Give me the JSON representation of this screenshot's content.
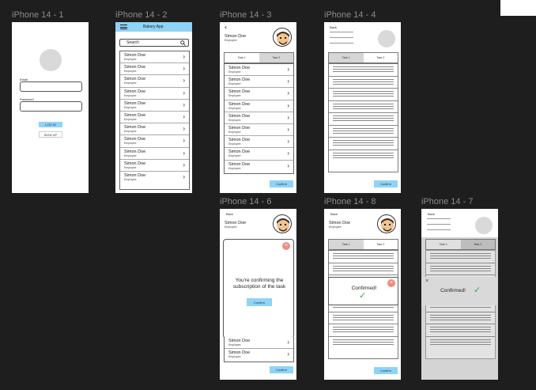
{
  "frames": {
    "f1": "iPhone 14 - 1",
    "f2": "iPhone 14 - 2",
    "f3": "iPhone 14 - 3",
    "f4": "iPhone 14 - 4",
    "f6": "iPhone 14 - 6",
    "f8": "iPhone 14 - 8",
    "f7": "iPhone 14 - 7"
  },
  "login": {
    "email_label": "Email",
    "password_label": "Password",
    "login_button": "LOG IN",
    "signup_button": "SIGN UP"
  },
  "bakery": {
    "title": "Bakery App",
    "search_placeholder": "Search",
    "items": [
      {
        "name": "Simon Doe",
        "role": "Employee"
      },
      {
        "name": "Simon Doe",
        "role": "Employee"
      },
      {
        "name": "Simon Doe",
        "role": "Employee"
      },
      {
        "name": "Simon Doe",
        "role": "Employee"
      },
      {
        "name": "Simon Doe",
        "role": "Employee"
      },
      {
        "name": "Simon Doe",
        "role": "Employee"
      },
      {
        "name": "Simon Doe",
        "role": "Employee"
      },
      {
        "name": "Simon Doe",
        "role": "Employee"
      },
      {
        "name": "Simon Doe",
        "role": "Employee"
      },
      {
        "name": "Simon Doe",
        "role": "Employee"
      },
      {
        "name": "Simon Doe",
        "role": "Employee"
      }
    ]
  },
  "profile": {
    "name": "Simon Doe",
    "role": "Employee",
    "tab1": "Task 1",
    "tab2": "Task 2",
    "confirm_button": "Confirm",
    "back_label": "Back"
  },
  "employees": [
    {
      "name": "Simon Doe",
      "role": "Employee"
    },
    {
      "name": "Simon Doe",
      "role": "Employee"
    },
    {
      "name": "Simon Doe",
      "role": "Employee"
    },
    {
      "name": "Simon Doe",
      "role": "Employee"
    },
    {
      "name": "Simon Doe",
      "role": "Employee"
    },
    {
      "name": "Simon Doe",
      "role": "Employee"
    },
    {
      "name": "Simon Doe",
      "role": "Employee"
    },
    {
      "name": "Simon Doe",
      "role": "Employee"
    },
    {
      "name": "Simon Doe",
      "role": "Employee"
    },
    {
      "name": "Simon Doe",
      "role": "Employee"
    }
  ],
  "dialog": {
    "message": "You're confirming the subscription of the task",
    "confirm": "Confirm",
    "confirmed": "Confirmed!"
  },
  "colors": {
    "accent": "#8fd3f7",
    "close": "#f28b82",
    "check": "#34a853"
  }
}
